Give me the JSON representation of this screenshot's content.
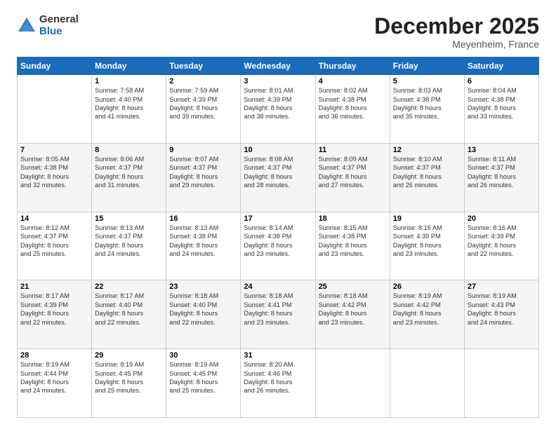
{
  "logo": {
    "general": "General",
    "blue": "Blue"
  },
  "title": "December 2025",
  "location": "Meyenheim, France",
  "days_of_week": [
    "Sunday",
    "Monday",
    "Tuesday",
    "Wednesday",
    "Thursday",
    "Friday",
    "Saturday"
  ],
  "weeks": [
    [
      {
        "num": "",
        "sunrise": "",
        "sunset": "",
        "daylight": ""
      },
      {
        "num": "1",
        "sunrise": "Sunrise: 7:58 AM",
        "sunset": "Sunset: 4:40 PM",
        "daylight": "Daylight: 8 hours and 41 minutes."
      },
      {
        "num": "2",
        "sunrise": "Sunrise: 7:59 AM",
        "sunset": "Sunset: 4:39 PM",
        "daylight": "Daylight: 8 hours and 39 minutes."
      },
      {
        "num": "3",
        "sunrise": "Sunrise: 8:01 AM",
        "sunset": "Sunset: 4:39 PM",
        "daylight": "Daylight: 8 hours and 38 minutes."
      },
      {
        "num": "4",
        "sunrise": "Sunrise: 8:02 AM",
        "sunset": "Sunset: 4:38 PM",
        "daylight": "Daylight: 8 hours and 36 minutes."
      },
      {
        "num": "5",
        "sunrise": "Sunrise: 8:03 AM",
        "sunset": "Sunset: 4:38 PM",
        "daylight": "Daylight: 8 hours and 35 minutes."
      },
      {
        "num": "6",
        "sunrise": "Sunrise: 8:04 AM",
        "sunset": "Sunset: 4:38 PM",
        "daylight": "Daylight: 8 hours and 33 minutes."
      }
    ],
    [
      {
        "num": "7",
        "sunrise": "Sunrise: 8:05 AM",
        "sunset": "Sunset: 4:38 PM",
        "daylight": "Daylight: 8 hours and 32 minutes."
      },
      {
        "num": "8",
        "sunrise": "Sunrise: 8:06 AM",
        "sunset": "Sunset: 4:37 PM",
        "daylight": "Daylight: 8 hours and 31 minutes."
      },
      {
        "num": "9",
        "sunrise": "Sunrise: 8:07 AM",
        "sunset": "Sunset: 4:37 PM",
        "daylight": "Daylight: 8 hours and 29 minutes."
      },
      {
        "num": "10",
        "sunrise": "Sunrise: 8:08 AM",
        "sunset": "Sunset: 4:37 PM",
        "daylight": "Daylight: 8 hours and 28 minutes."
      },
      {
        "num": "11",
        "sunrise": "Sunrise: 8:09 AM",
        "sunset": "Sunset: 4:37 PM",
        "daylight": "Daylight: 8 hours and 27 minutes."
      },
      {
        "num": "12",
        "sunrise": "Sunrise: 8:10 AM",
        "sunset": "Sunset: 4:37 PM",
        "daylight": "Daylight: 8 hours and 26 minutes."
      },
      {
        "num": "13",
        "sunrise": "Sunrise: 8:11 AM",
        "sunset": "Sunset: 4:37 PM",
        "daylight": "Daylight: 8 hours and 26 minutes."
      }
    ],
    [
      {
        "num": "14",
        "sunrise": "Sunrise: 8:12 AM",
        "sunset": "Sunset: 4:37 PM",
        "daylight": "Daylight: 8 hours and 25 minutes."
      },
      {
        "num": "15",
        "sunrise": "Sunrise: 8:13 AM",
        "sunset": "Sunset: 4:37 PM",
        "daylight": "Daylight: 8 hours and 24 minutes."
      },
      {
        "num": "16",
        "sunrise": "Sunrise: 8:13 AM",
        "sunset": "Sunset: 4:38 PM",
        "daylight": "Daylight: 8 hours and 24 minutes."
      },
      {
        "num": "17",
        "sunrise": "Sunrise: 8:14 AM",
        "sunset": "Sunset: 4:38 PM",
        "daylight": "Daylight: 8 hours and 23 minutes."
      },
      {
        "num": "18",
        "sunrise": "Sunrise: 8:15 AM",
        "sunset": "Sunset: 4:38 PM",
        "daylight": "Daylight: 8 hours and 23 minutes."
      },
      {
        "num": "19",
        "sunrise": "Sunrise: 8:16 AM",
        "sunset": "Sunset: 4:39 PM",
        "daylight": "Daylight: 8 hours and 23 minutes."
      },
      {
        "num": "20",
        "sunrise": "Sunrise: 8:16 AM",
        "sunset": "Sunset: 4:39 PM",
        "daylight": "Daylight: 8 hours and 22 minutes."
      }
    ],
    [
      {
        "num": "21",
        "sunrise": "Sunrise: 8:17 AM",
        "sunset": "Sunset: 4:39 PM",
        "daylight": "Daylight: 8 hours and 22 minutes."
      },
      {
        "num": "22",
        "sunrise": "Sunrise: 8:17 AM",
        "sunset": "Sunset: 4:40 PM",
        "daylight": "Daylight: 8 hours and 22 minutes."
      },
      {
        "num": "23",
        "sunrise": "Sunrise: 8:18 AM",
        "sunset": "Sunset: 4:40 PM",
        "daylight": "Daylight: 8 hours and 22 minutes."
      },
      {
        "num": "24",
        "sunrise": "Sunrise: 8:18 AM",
        "sunset": "Sunset: 4:41 PM",
        "daylight": "Daylight: 8 hours and 23 minutes."
      },
      {
        "num": "25",
        "sunrise": "Sunrise: 8:18 AM",
        "sunset": "Sunset: 4:42 PM",
        "daylight": "Daylight: 8 hours and 23 minutes."
      },
      {
        "num": "26",
        "sunrise": "Sunrise: 8:19 AM",
        "sunset": "Sunset: 4:42 PM",
        "daylight": "Daylight: 8 hours and 23 minutes."
      },
      {
        "num": "27",
        "sunrise": "Sunrise: 8:19 AM",
        "sunset": "Sunset: 4:43 PM",
        "daylight": "Daylight: 8 hours and 24 minutes."
      }
    ],
    [
      {
        "num": "28",
        "sunrise": "Sunrise: 8:19 AM",
        "sunset": "Sunset: 4:44 PM",
        "daylight": "Daylight: 8 hours and 24 minutes."
      },
      {
        "num": "29",
        "sunrise": "Sunrise: 8:19 AM",
        "sunset": "Sunset: 4:45 PM",
        "daylight": "Daylight: 8 hours and 25 minutes."
      },
      {
        "num": "30",
        "sunrise": "Sunrise: 8:19 AM",
        "sunset": "Sunset: 4:45 PM",
        "daylight": "Daylight: 8 hours and 25 minutes."
      },
      {
        "num": "31",
        "sunrise": "Sunrise: 8:20 AM",
        "sunset": "Sunset: 4:46 PM",
        "daylight": "Daylight: 8 hours and 26 minutes."
      },
      {
        "num": "",
        "sunrise": "",
        "sunset": "",
        "daylight": ""
      },
      {
        "num": "",
        "sunrise": "",
        "sunset": "",
        "daylight": ""
      },
      {
        "num": "",
        "sunrise": "",
        "sunset": "",
        "daylight": ""
      }
    ]
  ]
}
